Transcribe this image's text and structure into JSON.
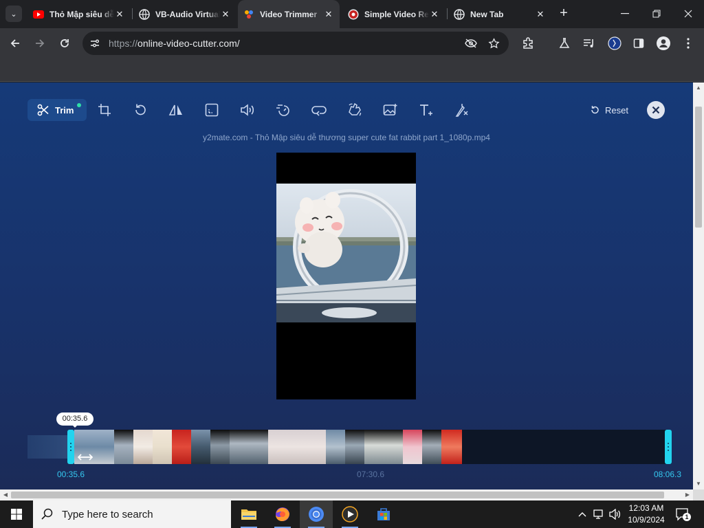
{
  "browser": {
    "tabs": [
      {
        "title": "Thỏ Mập siêu dễ thương",
        "favicon": "youtube-icon",
        "active": false
      },
      {
        "title": "VB-Audio Virtual Apps",
        "favicon": "globe-icon",
        "active": false
      },
      {
        "title": "Video Trimmer",
        "favicon": "video-trimmer-icon",
        "active": true
      },
      {
        "title": "Simple Video Recorder",
        "favicon": "record-icon",
        "active": false
      },
      {
        "title": "New Tab",
        "favicon": "globe-icon",
        "active": false
      }
    ],
    "url_scheme": "https://",
    "url_rest": "online-video-cutter.com/"
  },
  "editor": {
    "tools": [
      {
        "name": "trim",
        "label": "Trim",
        "icon": "scissors-icon",
        "active": true
      },
      {
        "name": "crop",
        "icon": "crop-icon"
      },
      {
        "name": "rotate",
        "icon": "rotate-icon"
      },
      {
        "name": "flip",
        "icon": "flip-icon"
      },
      {
        "name": "resize",
        "icon": "resize-icon"
      },
      {
        "name": "volume",
        "icon": "volume-icon"
      },
      {
        "name": "speed",
        "icon": "speed-icon"
      },
      {
        "name": "loop",
        "icon": "loop-icon"
      },
      {
        "name": "stabilize",
        "icon": "stabilize-icon"
      },
      {
        "name": "image",
        "icon": "image-icon"
      },
      {
        "name": "text",
        "icon": "text-icon"
      },
      {
        "name": "remove-logo",
        "icon": "remove-logo-icon"
      }
    ],
    "reset_label": "Reset",
    "filename": "y2mate.com - Thỏ Mập siêu dễ thương super cute fat rabbit part 1_1080p.mp4"
  },
  "timeline": {
    "bubble": "00:35.6",
    "start": "00:35.6",
    "middle": "07:30.6",
    "end": "08:06.3"
  },
  "taskbar": {
    "search_placeholder": "Type here to search",
    "time": "12:03 AM",
    "date": "10/9/2024",
    "notification_count": "1"
  },
  "colors": {
    "accent": "#22d3ee",
    "page_bg": "#18326a",
    "trim_dot": "#2fe0a7"
  }
}
